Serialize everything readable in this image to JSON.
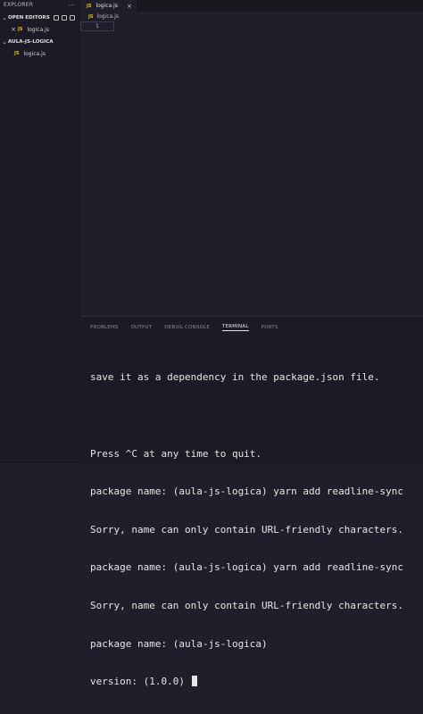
{
  "explorer": {
    "title": "EXPLORER",
    "more": "···",
    "open_editors": {
      "label": "OPEN EDITORS",
      "files": [
        {
          "badge": "JS",
          "name": "logica.js",
          "close": "×"
        }
      ]
    },
    "workspace": {
      "label": "AULA-JS-LOGICA",
      "files": [
        {
          "badge": "JS",
          "name": "logica.js"
        }
      ]
    }
  },
  "editor": {
    "tab": {
      "badge": "JS",
      "name": "logica.js",
      "close": "×"
    },
    "breadcrumb": {
      "badge": "JS",
      "name": "logica.js"
    },
    "find_value": "1"
  },
  "panel": {
    "tabs": [
      "PROBLEMS",
      "OUTPUT",
      "DEBUG CONSOLE",
      "TERMINAL",
      "PORTS"
    ],
    "active_tab": "TERMINAL",
    "terminal_lines": [
      "save it as a dependency in the package.json file.",
      "",
      "Press ^C at any time to quit.",
      "package name: (aula-js-logica) yarn add readline-sync",
      "Sorry, name can only contain URL-friendly characters.",
      "package name: (aula-js-logica) yarn add readline-sync",
      "Sorry, name can only contain URL-friendly characters.",
      "package name: (aula-js-logica)",
      "version: (1.0.0) "
    ]
  },
  "colors": {
    "editor_bg": "#1e1f2b",
    "sidebar_bg": "#1a1b25",
    "js_badge": "#e5c100"
  }
}
